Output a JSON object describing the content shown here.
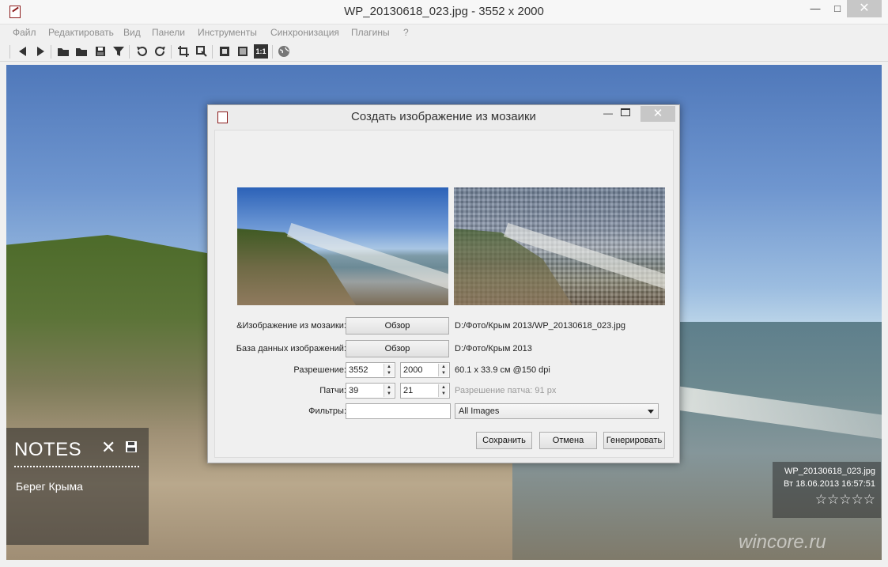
{
  "window": {
    "title": "WP_20130618_023.jpg  - 3552 x 2000",
    "min_glyph": "—",
    "max_glyph": "□",
    "close_glyph": "✕"
  },
  "menu": [
    "Файл",
    "Редактировать",
    "Вид",
    "Панели",
    "Инструменты",
    "Синхронизация",
    "Плагины",
    "?"
  ],
  "toolbar": {
    "icons": [
      "back-icon",
      "forward-icon",
      "open-folder-icon",
      "folder-icon",
      "save-icon",
      "filter-icon",
      "rotate-left-icon",
      "rotate-right-icon",
      "crop-icon",
      "resize-icon",
      "fit-icon",
      "fullscreen-icon",
      "actual-size-icon",
      "globe-icon"
    ],
    "actual_size_label": "1:1"
  },
  "notes": {
    "title": "NOTES",
    "close_glyph": "✕",
    "text": "Берег Крыма"
  },
  "info": {
    "filename": "WP_20130618_023.jpg",
    "date": "Вт 18.06.2013 16:57:51",
    "stars": "☆☆☆☆☆",
    "rating": 0
  },
  "watermark": "wincore.ru",
  "dialog": {
    "title": "Создать изображение из мозаики",
    "min_glyph": "—",
    "close_glyph": "✕",
    "mosaic_image_label": "&Изображение из мозаики:",
    "browse_label": "Обзор",
    "mosaic_image_path": "D:/Фото/Крым 2013/WP_20130618_023.jpg",
    "database_label": "База данных изображений:",
    "database_path": "D:/Фото/Крым 2013",
    "resolution_label": "Разрешение:",
    "resolution_width": "3552",
    "resolution_height": "2000",
    "resolution_info": "60.1 x 33.9 см @150 dpi",
    "patches_label": "Патчи:",
    "patches_x": "39",
    "patches_y": "21",
    "patch_resolution": "Разрешение патча: 91 px",
    "filters_label": "Фильтры:",
    "filters_value": "",
    "filter_select": "All Images",
    "save_button": "Сохранить",
    "cancel_button": "Отмена",
    "generate_button": "Генерировать"
  }
}
